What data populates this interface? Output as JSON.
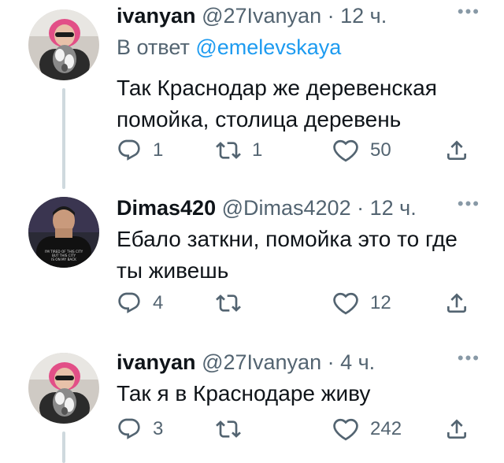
{
  "tweets": [
    {
      "name": "ivanyan",
      "handle": "@27Ivanyan",
      "time": "· 12 ч.",
      "reply_prefix": "В ответ",
      "reply_mention": "@emelevskaya",
      "text_lines": [
        "Так Краснодар же деревенская",
        "помойка, столица деревень"
      ],
      "replies": "1",
      "retweets": "1",
      "likes": "50"
    },
    {
      "name": "Dimas420",
      "handle": "@Dimas4202",
      "time": "· 12 ч.",
      "text_lines": [
        "Ебало заткни, помойка это то где",
        "ты живешь"
      ],
      "replies": "4",
      "retweets": "",
      "likes": "12"
    },
    {
      "name": "ivanyan",
      "handle": "@27Ivanyan",
      "time": "· 4 ч.",
      "text_lines": [
        "Так я в Краснодаре живу"
      ],
      "replies": "3",
      "retweets": "",
      "likes": "242"
    }
  ],
  "ui": {
    "more": "•••"
  },
  "avatars": {
    "dimas_shirt_text": "I'M TIRED OF THIS CITY BUT THIS CITY IS ON MY BACK"
  },
  "icons": [
    "reply-icon",
    "retweet-icon",
    "like-icon",
    "share-icon",
    "more-icon"
  ],
  "colors": {
    "accent": "#1d9bf0",
    "secondary_text": "#536471",
    "thread_line": "#cfd9de"
  }
}
